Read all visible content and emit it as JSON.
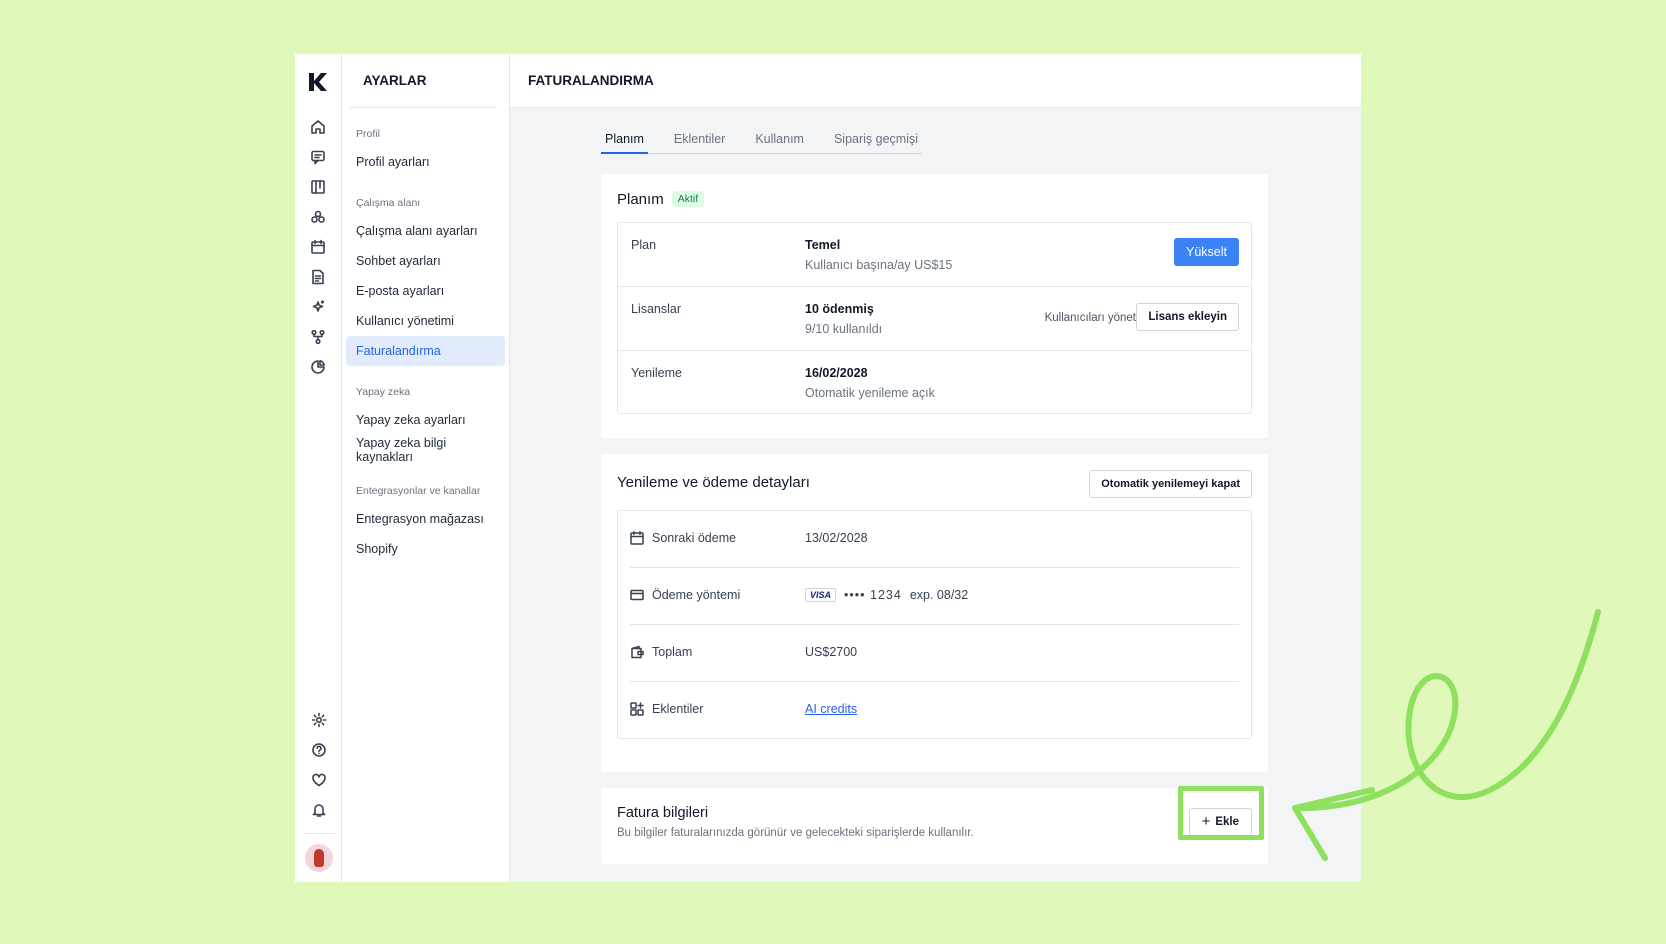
{
  "sidebar": {
    "title": "AYARLAR",
    "groups": [
      {
        "label": "Profil",
        "items": [
          "Profil ayarları"
        ]
      },
      {
        "label": "Çalışma alanı",
        "items": [
          "Çalışma alanı ayarları",
          "Sohbet ayarları",
          "E-posta ayarları",
          "Kullanıcı yönetimi",
          "Faturalandırma"
        ]
      },
      {
        "label": "Yapay zeka",
        "items": [
          "Yapay zeka ayarları",
          "Yapay zeka bilgi kaynakları"
        ]
      },
      {
        "label": "Entegrasyonlar ve kanallar",
        "items": [
          "Entegrasyon mağazası",
          "Shopify"
        ]
      }
    ],
    "active_item": "Faturalandırma"
  },
  "header": {
    "title": "FATURALANDIRMA"
  },
  "tabs": [
    "Planım",
    "Eklentiler",
    "Kullanım",
    "Sipariş geçmişi"
  ],
  "active_tab": "Planım",
  "plan_card": {
    "title": "Planım",
    "status": "Aktif",
    "rows": {
      "plan": {
        "label": "Plan",
        "main": "Temel",
        "sub": "Kullanıcı başına/ay US$15",
        "button": "Yükselt"
      },
      "licenses": {
        "label": "Lisanslar",
        "main": "10 ödenmiş",
        "sub": "9/10 kullanıldı",
        "link": "Kullanıcıları yönet",
        "button": "Lisans ekleyin"
      },
      "renewal": {
        "label": "Yenileme",
        "main": "16/02/2028",
        "sub": "Otomatik yenileme açık"
      }
    }
  },
  "payment_card": {
    "title": "Yenileme ve ödeme detayları",
    "button": "Otomatik yenilemeyi kapat",
    "rows": {
      "next_payment": {
        "label": "Sonraki ödeme",
        "value": "13/02/2028",
        "icon": "calendar-icon"
      },
      "method": {
        "label": "Ödeme yöntemi",
        "brand": "VISA",
        "masked": "•••• 1234",
        "expiry": "exp. 08/32",
        "icon": "credit-card-icon"
      },
      "total": {
        "label": "Toplam",
        "value": "US$2700",
        "icon": "wallet-icon"
      },
      "addons": {
        "label": "Eklentiler",
        "value": "AI credits",
        "icon": "addons-icon"
      }
    }
  },
  "invoice_card": {
    "title": "Fatura bilgileri",
    "subtitle": "Bu bilgiler faturalarınızda görünür ve gelecekteki siparişlerde kullanılır.",
    "button": "Ekle"
  },
  "colors": {
    "accent": "#3b82f6",
    "highlight": "#8ee05e",
    "background": "#e1f8bb"
  }
}
